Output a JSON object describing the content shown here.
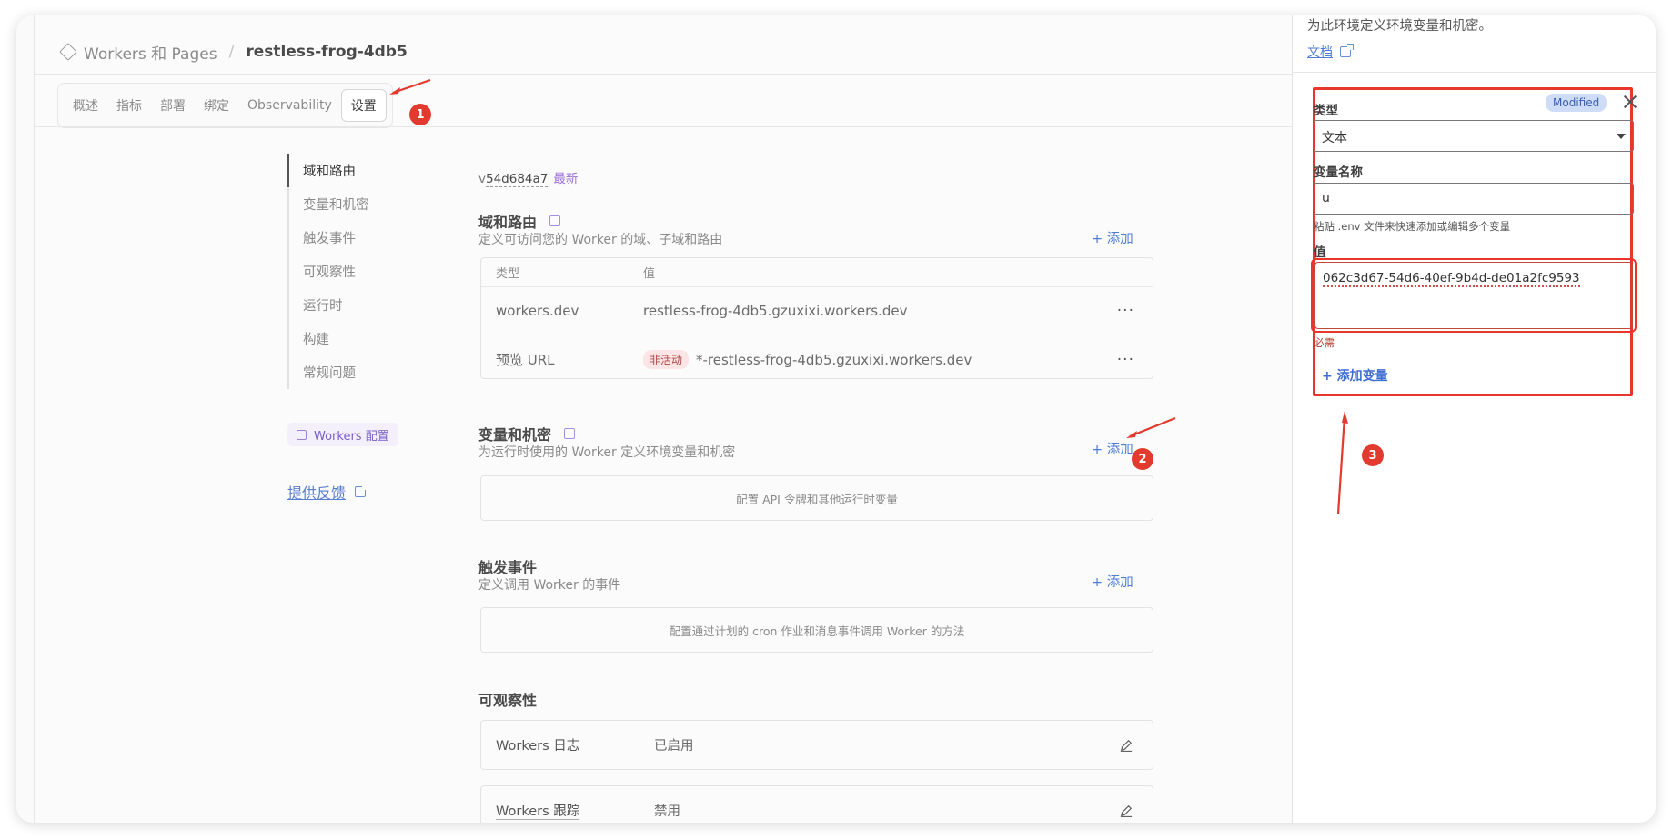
{
  "breadcrumb": {
    "parent": "Workers 和 Pages",
    "current": "restless-frog-4db5"
  },
  "tabs": [
    "概述",
    "指标",
    "部署",
    "绑定",
    "Observability",
    "设置"
  ],
  "sidenav": {
    "items": [
      "域和路由",
      "变量和机密",
      "触发事件",
      "可观察性",
      "运行时",
      "构建",
      "常规问题"
    ],
    "config_badge": "Workers 配置",
    "feedback": "提供反馈"
  },
  "version": {
    "prefix": "v",
    "hash": "54d684a7",
    "tag": "最新"
  },
  "domains": {
    "title": "域和路由",
    "subtitle": "定义可访问您的 Worker 的域、子域和路由",
    "add_label": "+ 添加",
    "columns": [
      "类型",
      "值"
    ],
    "rows": [
      {
        "type": "workers.dev",
        "value": "restless-frog-4db5.gzuxixi.workers.dev",
        "status": ""
      },
      {
        "type": "预览 URL",
        "value": "*-restless-frog-4db5.gzuxixi.workers.dev",
        "status": "非活动"
      }
    ]
  },
  "variables": {
    "title": "变量和机密",
    "subtitle": "为运行时使用的 Worker 定义环境变量和机密",
    "add_label": "+ 添加",
    "empty": "配置 API 令牌和其他运行时变量"
  },
  "triggers": {
    "title": "触发事件",
    "subtitle": "定义调用 Worker 的事件",
    "add_label": "+ 添加",
    "empty": "配置通过计划的 cron 作业和消息事件调用 Worker 的方法"
  },
  "observability": {
    "title": "可观察性",
    "rows": [
      {
        "name": "Workers 日志",
        "value": "已启用"
      },
      {
        "name": "Workers 跟踪",
        "value": "禁用"
      }
    ]
  },
  "panel": {
    "description": "为此环境定义环境变量和机密。",
    "doc_link": "文档",
    "type_label": "类型",
    "modified_badge": "Modified",
    "type_value": "文本",
    "name_label": "变量名称",
    "name_value": "u",
    "name_hint": "粘贴 .env 文件来快速添加或编辑多个变量",
    "value_label": "值",
    "value_value": "062c3d67-54d6-40ef-9b4d-de01a2fc9593",
    "required": "必需",
    "add_variable": "+ 添加变量"
  },
  "annotations": [
    "1",
    "2",
    "3"
  ],
  "colors": {
    "accent": "#4f7dd6",
    "annotation": "#e23a2e",
    "purple": "#9b6dd6"
  }
}
